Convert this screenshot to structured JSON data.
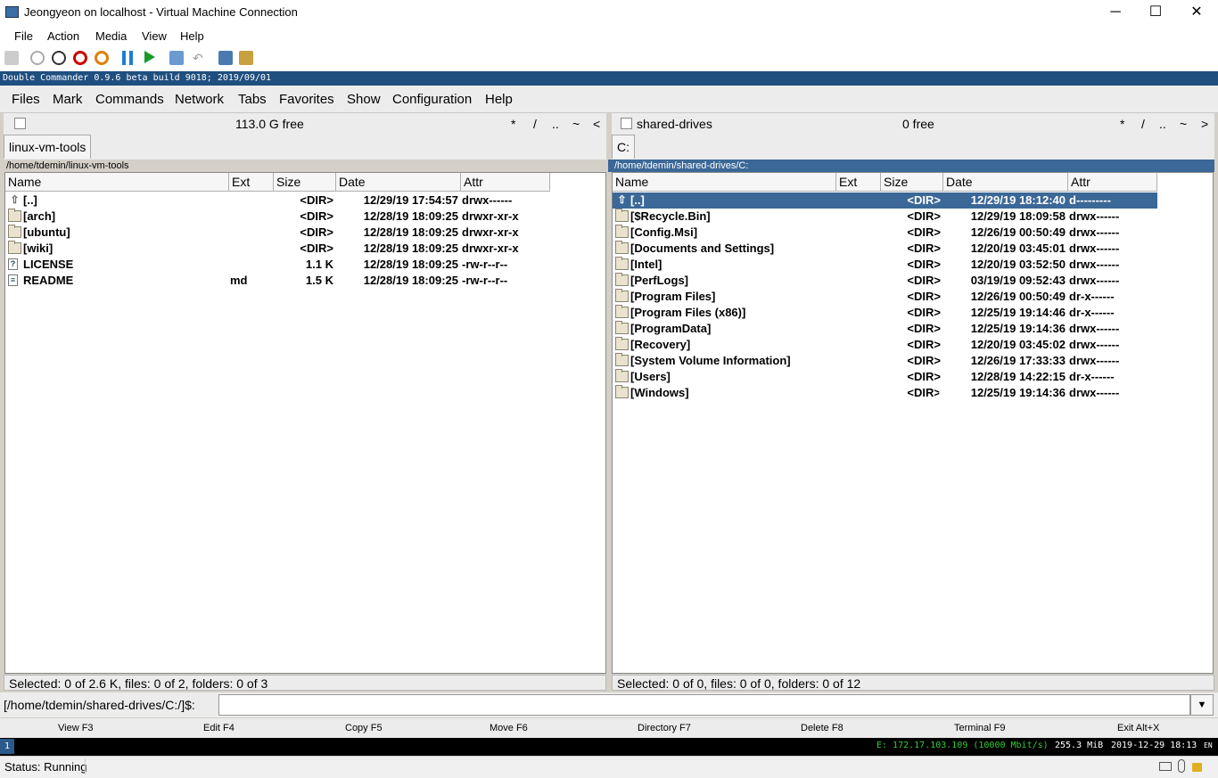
{
  "window": {
    "title": "Jeongyeon on localhost - Virtual Machine Connection",
    "minimize": "─",
    "maximize": "☐",
    "close": "✕"
  },
  "host_menu": [
    "File",
    "Action",
    "Media",
    "View",
    "Help"
  ],
  "host_toolbar_icons": [
    "ctrl-alt-del-icon",
    "start-icon",
    "turn-off-icon",
    "shutdown-icon",
    "save-icon",
    "pause-icon",
    "resume-icon",
    "checkpoint-icon",
    "revert-icon",
    "enhanced-session-icon",
    "share-icon"
  ],
  "app_banner": "Double Commander 0.9.6 beta build 9018; 2019/09/01",
  "dc_menu": [
    "Files",
    "Mark",
    "Commands",
    "Network",
    "Tabs",
    "Favorites",
    "Show",
    "Configuration",
    "Help"
  ],
  "left": {
    "free": "113.0 G free",
    "nav": [
      "*",
      "/",
      "..",
      "~",
      "<"
    ],
    "tab": "linux-vm-tools",
    "path": "/home/tdemin/linux-vm-tools",
    "columns": [
      "Name",
      "Ext",
      "Size",
      "Date",
      "Attr"
    ],
    "rows": [
      {
        "icon": "up",
        "name": "[..]",
        "ext": "",
        "size": "<DIR>",
        "date": "12/29/19 17:54:57",
        "attr": "drwx------"
      },
      {
        "icon": "folder",
        "name": "[arch]",
        "ext": "",
        "size": "<DIR>",
        "date": "12/28/19 18:09:25",
        "attr": "drwxr-xr-x"
      },
      {
        "icon": "folder",
        "name": "[ubuntu]",
        "ext": "",
        "size": "<DIR>",
        "date": "12/28/19 18:09:25",
        "attr": "drwxr-xr-x"
      },
      {
        "icon": "folder",
        "name": "[wiki]",
        "ext": "",
        "size": "<DIR>",
        "date": "12/28/19 18:09:25",
        "attr": "drwxr-xr-x"
      },
      {
        "icon": "unknown",
        "name": "LICENSE",
        "ext": "",
        "size": "1.1 K",
        "date": "12/28/19 18:09:25",
        "attr": "-rw-r--r--"
      },
      {
        "icon": "doc",
        "name": "README",
        "ext": "md",
        "size": "1.5 K",
        "date": "12/28/19 18:09:25",
        "attr": "-rw-r--r--"
      }
    ],
    "status": "Selected: 0 of 2.6 K, files: 0 of 2, folders: 0 of 3"
  },
  "right": {
    "drive": "shared-drives",
    "free": "0 free",
    "nav": [
      "*",
      "/",
      "..",
      "~",
      ">"
    ],
    "tab": "C:",
    "path": "/home/tdemin/shared-drives/C:",
    "columns": [
      "Name",
      "Ext",
      "Size",
      "Date",
      "Attr"
    ],
    "rows": [
      {
        "icon": "up",
        "name": "[..]",
        "ext": "",
        "size": "<DIR>",
        "date": "12/29/19 18:12:40",
        "attr": "d---------"
      },
      {
        "icon": "folder",
        "name": "[$Recycle.Bin]",
        "ext": "",
        "size": "<DIR>",
        "date": "12/29/19 18:09:58",
        "attr": "drwx------"
      },
      {
        "icon": "folder",
        "name": "[Config.Msi]",
        "ext": "",
        "size": "<DIR>",
        "date": "12/26/19 00:50:49",
        "attr": "drwx------"
      },
      {
        "icon": "folder",
        "name": "[Documents and Settings]",
        "ext": "",
        "size": "<DIR>",
        "date": "12/20/19 03:45:01",
        "attr": "drwx------"
      },
      {
        "icon": "folder",
        "name": "[Intel]",
        "ext": "",
        "size": "<DIR>",
        "date": "12/20/19 03:52:50",
        "attr": "drwx------"
      },
      {
        "icon": "folder",
        "name": "[PerfLogs]",
        "ext": "",
        "size": "<DIR>",
        "date": "03/19/19 09:52:43",
        "attr": "drwx------"
      },
      {
        "icon": "folder",
        "name": "[Program Files]",
        "ext": "",
        "size": "<DIR>",
        "date": "12/26/19 00:50:49",
        "attr": "dr-x------"
      },
      {
        "icon": "folder",
        "name": "[Program Files (x86)]",
        "ext": "",
        "size": "<DIR>",
        "date": "12/25/19 19:14:46",
        "attr": "dr-x------"
      },
      {
        "icon": "folder",
        "name": "[ProgramData]",
        "ext": "",
        "size": "<DIR>",
        "date": "12/25/19 19:14:36",
        "attr": "drwx------"
      },
      {
        "icon": "folder",
        "name": "[Recovery]",
        "ext": "",
        "size": "<DIR>",
        "date": "12/20/19 03:45:02",
        "attr": "drwx------"
      },
      {
        "icon": "folder",
        "name": "[System Volume Information]",
        "ext": "",
        "size": "<DIR>",
        "date": "12/26/19 17:33:33",
        "attr": "drwx------"
      },
      {
        "icon": "folder",
        "name": "[Users]",
        "ext": "",
        "size": "<DIR>",
        "date": "12/28/19 14:22:15",
        "attr": "dr-x------"
      },
      {
        "icon": "folder",
        "name": "[Windows]",
        "ext": "",
        "size": "<DIR>",
        "date": "12/25/19 19:14:36",
        "attr": "drwx------"
      }
    ],
    "status": "Selected: 0 of 0, files: 0 of 0, folders: 0 of 12"
  },
  "cmdline": {
    "prompt": "[/home/tdemin/shared-drives/C:/]$:",
    "value": ""
  },
  "fkeys": [
    "View F3",
    "Edit F4",
    "Copy F5",
    "Move F6",
    "Directory F7",
    "Delete F8",
    "Terminal F9",
    "Exit Alt+X"
  ],
  "guest_taskbar": {
    "workspace": "1",
    "net": "E: 172.17.103.109 (10000 Mbit/s)",
    "mem": "255.3 MiB",
    "clock": "2019-12-29 18:13",
    "layout": "EN"
  },
  "host_status": "Status: Running",
  "colors": {
    "banner": "#1f4f7f",
    "selection": "#3b6897",
    "net_green": "#33cc33"
  }
}
